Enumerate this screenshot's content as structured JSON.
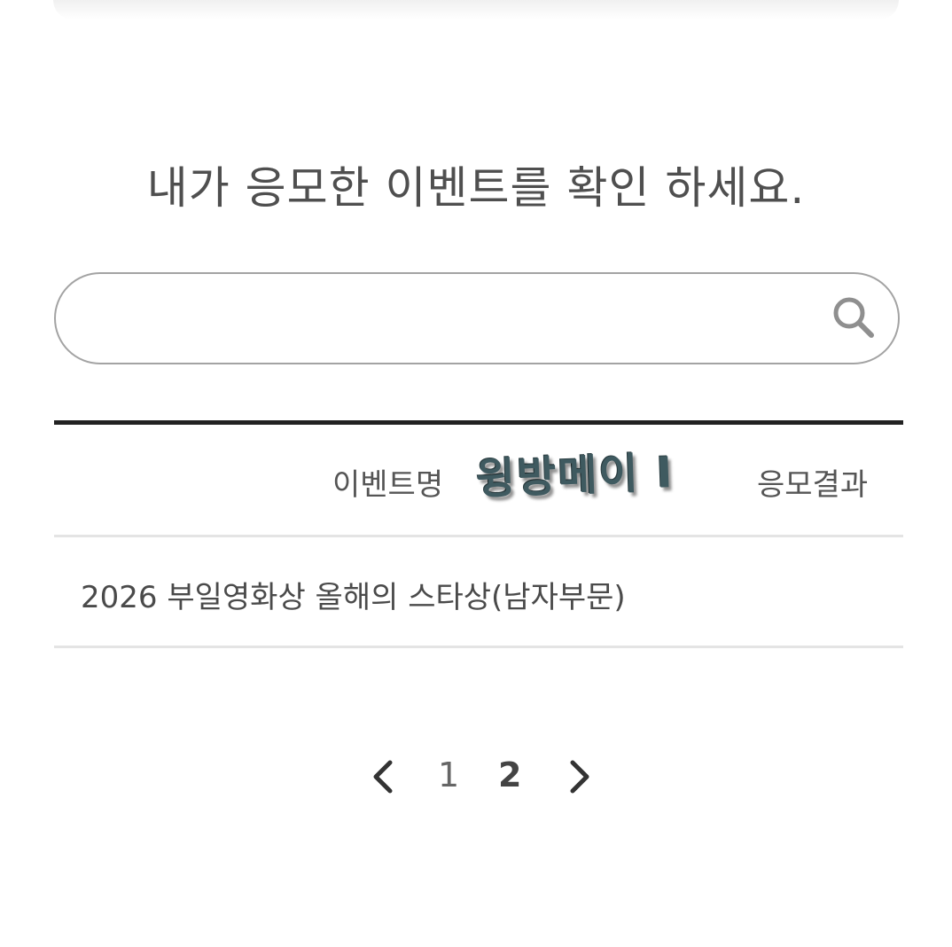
{
  "page": {
    "title": "내가 응모한 이벤트를 확인 하세요."
  },
  "search": {
    "placeholder": "",
    "value": ""
  },
  "table": {
    "headers": {
      "event_name": "이벤트명",
      "result": "응모결과"
    },
    "rows": [
      {
        "title": "2026 부일영화상 올해의 스타상(남자부문)",
        "result": ""
      }
    ]
  },
  "watermark": {
    "text": "윙방메이 I"
  },
  "pagination": {
    "pages": [
      "1",
      "2"
    ],
    "current": "2"
  },
  "icons": {
    "search": "search-icon",
    "prev": "chevron-left-icon",
    "next": "chevron-right-icon"
  },
  "colors": {
    "text": "#4a4a4a",
    "border": "#a3a3a3",
    "rule": "#222222",
    "divider": "#e4e4e4"
  }
}
